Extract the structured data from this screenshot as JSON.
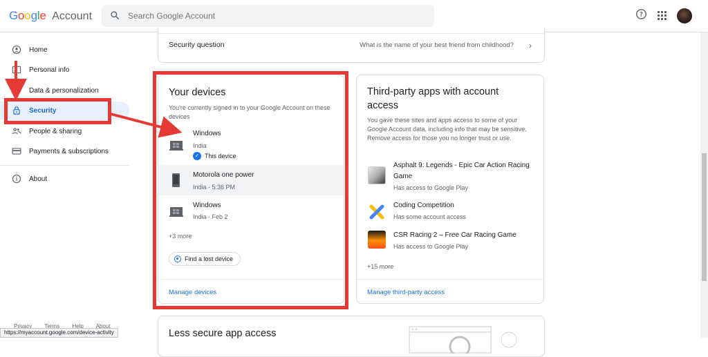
{
  "header": {
    "logo_google": "Google",
    "logo_account": "Account",
    "search_placeholder": "Search Google Account"
  },
  "sidebar": {
    "items": [
      {
        "label": "Home",
        "icon": "home-icon"
      },
      {
        "label": "Personal info",
        "icon": "id-card-icon"
      },
      {
        "label": "Data & personalization",
        "icon": "toggle-icon"
      },
      {
        "label": "Security",
        "icon": "lock-icon",
        "active": true
      },
      {
        "label": "People & sharing",
        "icon": "people-icon"
      },
      {
        "label": "Payments & subscriptions",
        "icon": "card-icon"
      },
      {
        "label": "About",
        "icon": "info-icon"
      }
    ],
    "footer": [
      "Privacy",
      "Terms",
      "Help",
      "About"
    ]
  },
  "security_question": {
    "label": "Security question",
    "value": "What is the name of your best friend from childhood?"
  },
  "devices": {
    "title": "Your devices",
    "desc": "You're currently signed in to your Google Account on these devices",
    "list": [
      {
        "name": "Windows",
        "sub": "India",
        "badge": "This device"
      },
      {
        "name": "Motorola one power",
        "sub": "India - 5:36 PM"
      },
      {
        "name": "Windows",
        "sub": "India - Feb 2"
      }
    ],
    "more": "+3 more",
    "find_button": "Find a lost device",
    "manage_link": "Manage devices"
  },
  "third_party": {
    "title": "Third-party apps with account access",
    "desc": "You gave these sites and apps access to some of your Google Account data, including info that may be sensitive. Remove access for those you no longer trust or use.",
    "apps": [
      {
        "name": "Asphalt 9: Legends - Epic Car Action Racing Game",
        "sub": "Has access to Google Play"
      },
      {
        "name": "Coding Competition",
        "sub": "Has some account access"
      },
      {
        "name": "CSR Racing 2 – Free Car Racing Game",
        "sub": "Has access to Google Play"
      }
    ],
    "more": "+15 more",
    "manage_link": "Manage third-party access"
  },
  "less_secure": {
    "title": "Less secure app access"
  },
  "statusbar": {
    "url": "https://myaccount.google.com/device-activity"
  },
  "colors": {
    "annotation_red": "#e53935",
    "link_blue": "#1a73e8",
    "active_bg": "#e8f0fe"
  }
}
